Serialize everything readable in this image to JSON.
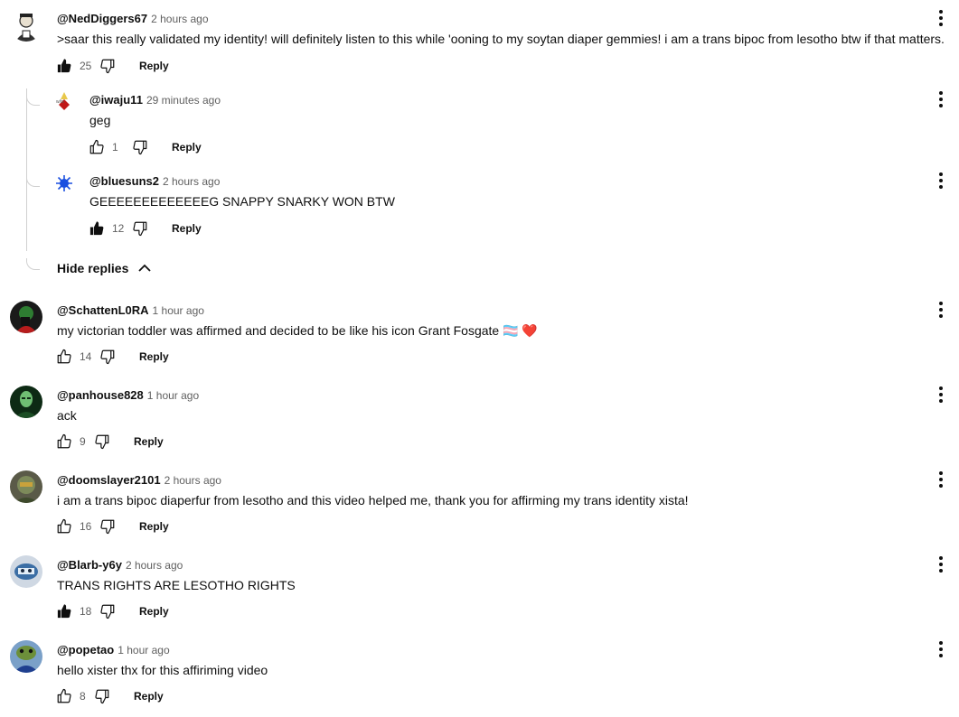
{
  "comments": [
    {
      "author": "@NedDiggers67",
      "time": "2 hours ago",
      "text": ">saar this really validated my identity! will definitely listen to this while 'ooning to my soytan diaper gemmies! i am a trans bipoc from lesotho btw if that matters.",
      "likes": "25",
      "liked": true,
      "reply_label": "Reply"
    },
    {
      "author": "@iwaju11",
      "time": "29 minutes ago",
      "text": "geg",
      "likes": "1",
      "liked": false,
      "reply_label": "Reply"
    },
    {
      "author": "@bluesuns2",
      "time": "2 hours ago",
      "text": "GEEEEEEEEEEEEEG SNAPPY SNARKY WON BTW",
      "likes": "12",
      "liked": true,
      "reply_label": "Reply"
    },
    {
      "author": "@SchattenL0RA",
      "time": "1 hour ago",
      "text": "my victorian toddler was affirmed and decided to be like his icon Grant Fosgate 🏳️‍⚧️ ❤️",
      "likes": "14",
      "liked": false,
      "reply_label": "Reply"
    },
    {
      "author": "@panhouse828",
      "time": "1 hour ago",
      "text": "ack",
      "likes": "9",
      "liked": false,
      "reply_label": "Reply"
    },
    {
      "author": "@doomslayer2101",
      "time": "2 hours ago",
      "text": "i am a trans bipoc diaperfur from lesotho and this video helped me, thank you for affirming my trans identity xista!",
      "likes": "16",
      "liked": false,
      "reply_label": "Reply"
    },
    {
      "author": "@Blarb-y6y",
      "time": "2 hours ago",
      "text": "TRANS RIGHTS ARE LESOTHO RIGHTS",
      "likes": "18",
      "liked": true,
      "reply_label": "Reply"
    },
    {
      "author": "@popetao",
      "time": "1 hour ago",
      "text": "hello xister thx for this affiriming video",
      "likes": "8",
      "liked": false,
      "reply_label": "Reply"
    }
  ],
  "hide_replies_label": "Hide replies",
  "colors": {
    "text": "#0f0f0f",
    "secondary": "#606060",
    "thread_line": "#d0d0d0"
  },
  "icons": [
    "like-icon",
    "like-filled-icon",
    "dislike-icon",
    "more-vert-icon",
    "chevron-up-icon"
  ]
}
